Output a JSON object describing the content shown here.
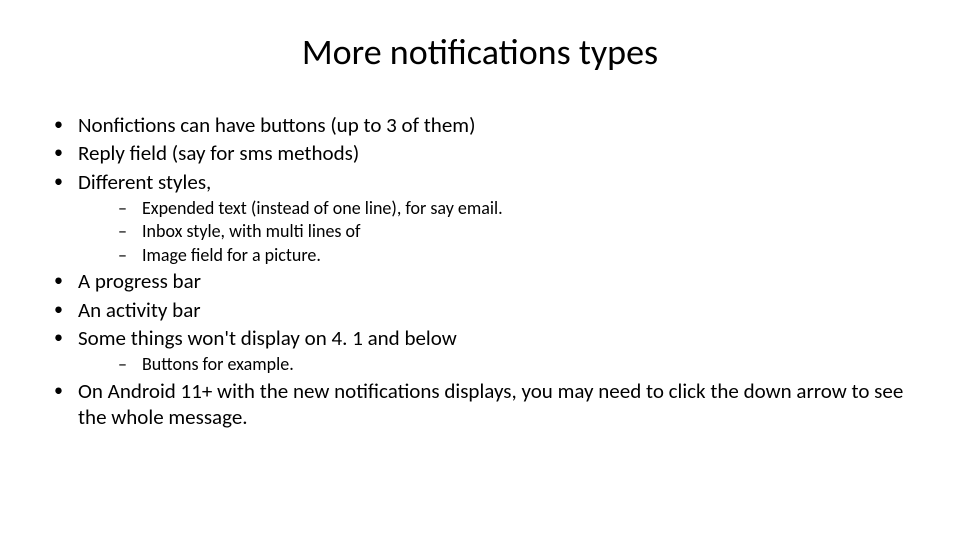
{
  "title": "More notifications types",
  "bullets": {
    "b1": "Nonfictions can have buttons (up to 3 of them)",
    "b2": "Reply field (say for sms methods)",
    "b3": "Different styles,",
    "b3_sub": {
      "s1": "Expended text (instead of one line), for say email.",
      "s2": "Inbox style, with multi lines of",
      "s3": "Image field for a picture."
    },
    "b4": "A progress bar",
    "b5": "An activity bar",
    "b6": "Some things won't display on 4. 1 and below",
    "b6_sub": {
      "s1": "Buttons for example."
    },
    "b7": "On Android 11+ with the new notifications displays, you may need to click the down arrow to see the whole message."
  }
}
